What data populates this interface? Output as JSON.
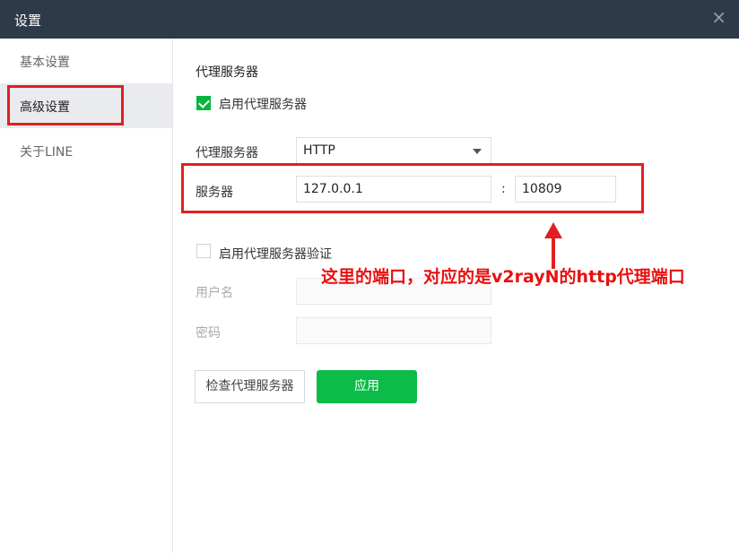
{
  "window": {
    "title": "设置",
    "close_icon": "×"
  },
  "sidebar": {
    "items": [
      {
        "label": "基本设置",
        "active": false
      },
      {
        "label": "高级设置",
        "active": true
      },
      {
        "label": "关于LINE",
        "active": false
      }
    ]
  },
  "proxy": {
    "section_title": "代理服务器",
    "enable_label": "启用代理服务器",
    "enable_checked": true,
    "type_label": "代理服务器",
    "type_value": "HTTP",
    "server_label": "服务器",
    "server_value": "127.0.0.1",
    "colon": ":",
    "port_value": "10809",
    "auth_label": "启用代理服务器验证",
    "auth_checked": false,
    "username_label": "用户名",
    "username_value": "",
    "password_label": "密码",
    "password_value": "",
    "check_button": "检查代理服务器",
    "apply_button": "应用"
  },
  "annotation": {
    "text": "这里的端口，对应的是v2rayN的http代理端口",
    "color": "#e81010"
  },
  "colors": {
    "titlebar": "#2f3a48",
    "accent_green": "#0dbb48",
    "highlight_red": "#e02020"
  }
}
